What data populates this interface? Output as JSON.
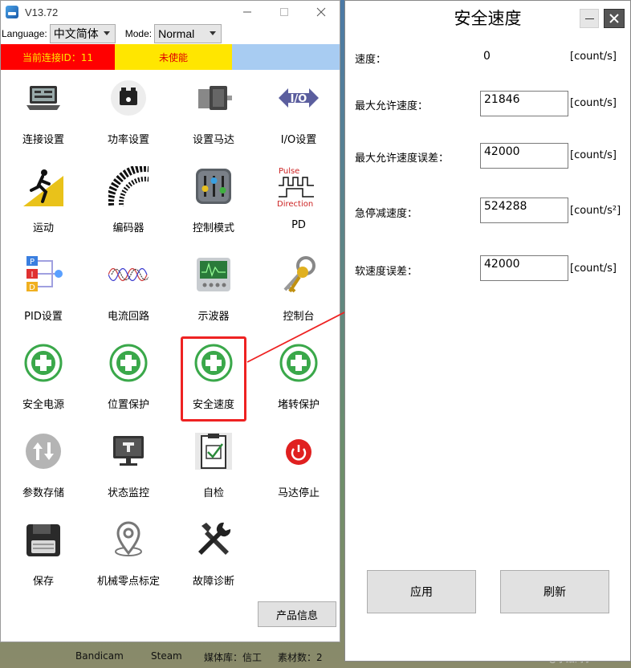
{
  "window": {
    "title": "V13.72"
  },
  "toolbar": {
    "language_label": "Language:",
    "language_value": "中文简体",
    "mode_label": "Mode:",
    "mode_value": "Normal"
  },
  "status": {
    "connection": "当前连接ID：11",
    "enable": "未使能",
    "colors": {
      "connection_bg": "#ff0000",
      "enable_bg": "#ffe600",
      "spare_bg": "#a8ccf2"
    }
  },
  "tiles": [
    {
      "label": "连接设置",
      "icon": "laptop-icon"
    },
    {
      "label": "功率设置",
      "icon": "power-icon"
    },
    {
      "label": "设置马达",
      "icon": "motor-icon"
    },
    {
      "label": "I/O设置",
      "icon": "io-icon"
    },
    {
      "label": "运动",
      "icon": "runner-icon"
    },
    {
      "label": "编码器",
      "icon": "encoder-icon"
    },
    {
      "label": "控制模式",
      "icon": "control-panel-icon"
    },
    {
      "label": "PD",
      "icon": "pulse-direction-icon",
      "icon_text_top": "Pulse",
      "icon_text_bottom": "Direction"
    },
    {
      "label": "PID设置",
      "icon": "pid-icon"
    },
    {
      "label": "电流回路",
      "icon": "wave-icon"
    },
    {
      "label": "示波器",
      "icon": "oscilloscope-icon"
    },
    {
      "label": "控制台",
      "icon": "keys-icon"
    },
    {
      "label": "安全电源",
      "icon": "green-cross-icon"
    },
    {
      "label": "位置保护",
      "icon": "green-cross-icon"
    },
    {
      "label": "安全速度",
      "icon": "green-cross-icon"
    },
    {
      "label": "堵转保护",
      "icon": "green-cross-icon"
    },
    {
      "label": "参数存储",
      "icon": "storage-icon"
    },
    {
      "label": "状态监控",
      "icon": "monitor-icon"
    },
    {
      "label": "自检",
      "icon": "checklist-icon"
    },
    {
      "label": "马达停止",
      "icon": "stop-icon"
    },
    {
      "label": "保存",
      "icon": "floppy-icon"
    },
    {
      "label": "机械零点标定",
      "icon": "location-pin-icon"
    },
    {
      "label": "故障诊断",
      "icon": "tools-icon"
    }
  ],
  "product_info": "产品信息",
  "dialog": {
    "title": "安全速度",
    "speed_label": "速度：",
    "speed_value": "0",
    "speed_unit": "[count/s]",
    "max_speed_label": "最大允许速度：",
    "max_speed_value": "21846",
    "max_speed_unit": "[count/s]",
    "max_speed_err_label": "最大允许速度误差：",
    "max_speed_err_value": "42000",
    "max_speed_err_unit": "[count/s]",
    "estop_decel_label": "急停减速度：",
    "estop_decel_value": "524288",
    "estop_decel_unit": "[count/s²]",
    "soft_speed_err_label": "软速度误差：",
    "soft_speed_err_value": "42000",
    "soft_speed_err_unit": "[count/s]",
    "apply": "应用",
    "refresh": "刷新"
  },
  "taskbar": {
    "item1": "Bandicam",
    "item2": "Steam",
    "item3": "媒体库：信工",
    "item4": "素材数：2"
  },
  "watermark": "CSDN @小聂同学61"
}
